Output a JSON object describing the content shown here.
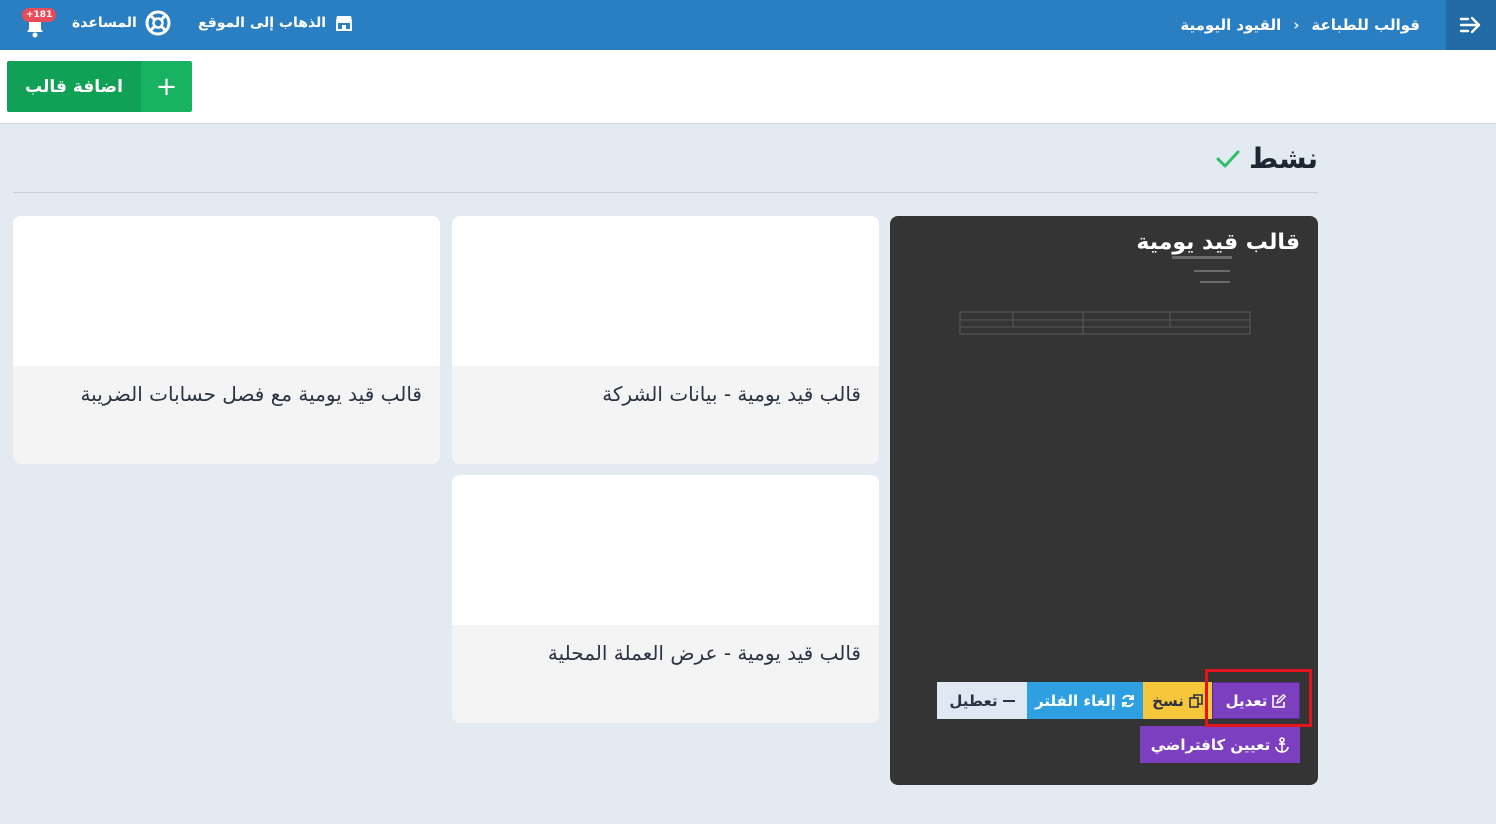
{
  "topbar": {
    "breadcrumb": [
      "قوالب للطباعة",
      "القيود اليومية"
    ],
    "separator": "›",
    "help_label": "المساعدة",
    "site_label": "الذهاب إلى الموقع",
    "notifications_count": "+181",
    "menu_icon": "arrow-right-bar-icon",
    "colors": {
      "bar": "#2a7ec2",
      "toggle": "#226aa6"
    }
  },
  "toolbar": {
    "add_label": "اضافة قالب",
    "add_icon": "+",
    "color": "#10a157"
  },
  "section": {
    "title": "نشط",
    "check_color": "#2fbf6b"
  },
  "templates": {
    "active": {
      "title": "قالب قيد يومية",
      "actions": {
        "edit": "تعديل",
        "copy": "نسخ",
        "clear_filter": "إلغاء الفلتر",
        "disable": "تعطيل",
        "set_default": "تعيين كافتراضي"
      }
    },
    "cards": [
      {
        "title": "قالب قيد يومية - بيانات الشركة"
      },
      {
        "title": "قالب قيد يومية مع فصل حسابات الضريبة"
      },
      {
        "title": "قالب قيد يومية - عرض العملة المحلية"
      }
    ]
  }
}
